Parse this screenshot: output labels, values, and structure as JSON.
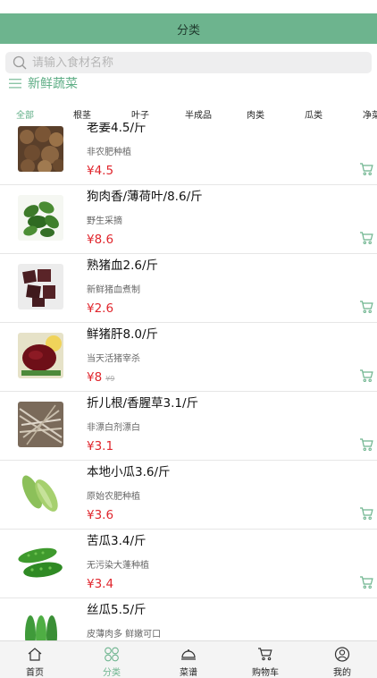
{
  "header": {
    "title": "分类"
  },
  "search": {
    "placeholder": "请输入食材名称"
  },
  "section": {
    "title": "新鲜蔬菜"
  },
  "tabs": [
    {
      "label": "全部",
      "active": true
    },
    {
      "label": "根茎",
      "active": false
    },
    {
      "label": "叶子",
      "active": false
    },
    {
      "label": "半成品",
      "active": false
    },
    {
      "label": "肉类",
      "active": false
    },
    {
      "label": "瓜类",
      "active": false
    },
    {
      "label": "净菜",
      "active": false
    }
  ],
  "products": [
    {
      "name": "老姜4.5/斤",
      "desc": "非农肥种植",
      "price": "¥4.5",
      "old_price": ""
    },
    {
      "name": "狗肉香/薄荷叶/8.6/斤",
      "desc": "野生采摘",
      "price": "¥8.6",
      "old_price": ""
    },
    {
      "name": "熟猪血2.6/斤",
      "desc": "新鲜猪血煮制",
      "price": "¥2.6",
      "old_price": ""
    },
    {
      "name": "鲜猪肝8.0/斤",
      "desc": "当天活猪宰杀",
      "price": "¥8",
      "old_price": "¥9"
    },
    {
      "name": "折儿根/香腥草3.1/斤",
      "desc": "非漂白剂漂白",
      "price": "¥3.1",
      "old_price": ""
    },
    {
      "name": "本地小瓜3.6/斤",
      "desc": "原始农肥种植",
      "price": "¥3.6",
      "old_price": ""
    },
    {
      "name": "苦瓜3.4/斤",
      "desc": "无污染大蓬种植",
      "price": "¥3.4",
      "old_price": ""
    },
    {
      "name": "丝瓜5.5/斤",
      "desc": "皮薄肉多 鲜嫩可口",
      "price": "",
      "old_price": ""
    }
  ],
  "bottom_nav": [
    {
      "label": "首页",
      "icon": "home-icon",
      "active": false
    },
    {
      "label": "分类",
      "icon": "category-icon",
      "active": true
    },
    {
      "label": "菜谱",
      "icon": "recipe-cloche-icon",
      "active": false
    },
    {
      "label": "购物车",
      "icon": "cart-icon",
      "active": false
    },
    {
      "label": "我的",
      "icon": "user-icon",
      "active": false
    }
  ],
  "colors": {
    "brand": "#6db48e",
    "accent_text": "#5fae86",
    "price": "#e0262d"
  }
}
